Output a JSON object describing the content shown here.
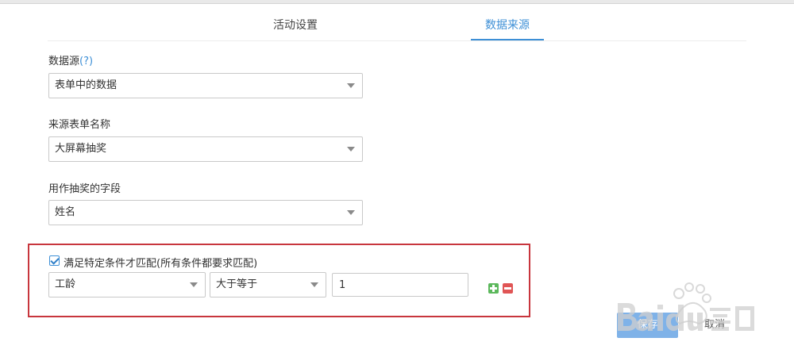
{
  "tabs": [
    {
      "label": "活动设置",
      "active": false
    },
    {
      "label": "数据来源",
      "active": true
    }
  ],
  "data_source": {
    "label": "数据源",
    "help": "(?)",
    "value": "表单中的数据"
  },
  "source_form": {
    "label": "来源表单名称",
    "value": "大屏幕抽奖"
  },
  "lottery_field": {
    "label": "用作抽奖的字段",
    "value": "姓名"
  },
  "condition": {
    "checked": true,
    "label": "满足特定条件才匹配(所有条件都要求匹配)",
    "field": "工龄",
    "operator": "大于等于",
    "value": "1"
  },
  "actions": {
    "save_label": "保存",
    "cancel_label": "取消"
  },
  "colors": {
    "accent": "#3d8fd6",
    "highlight_border": "#c8363d",
    "add": "#5cb85c",
    "remove": "#e05555"
  },
  "icons": {
    "add": "plus-icon",
    "remove": "minus-icon",
    "dropdown": "chevron-down-icon"
  }
}
